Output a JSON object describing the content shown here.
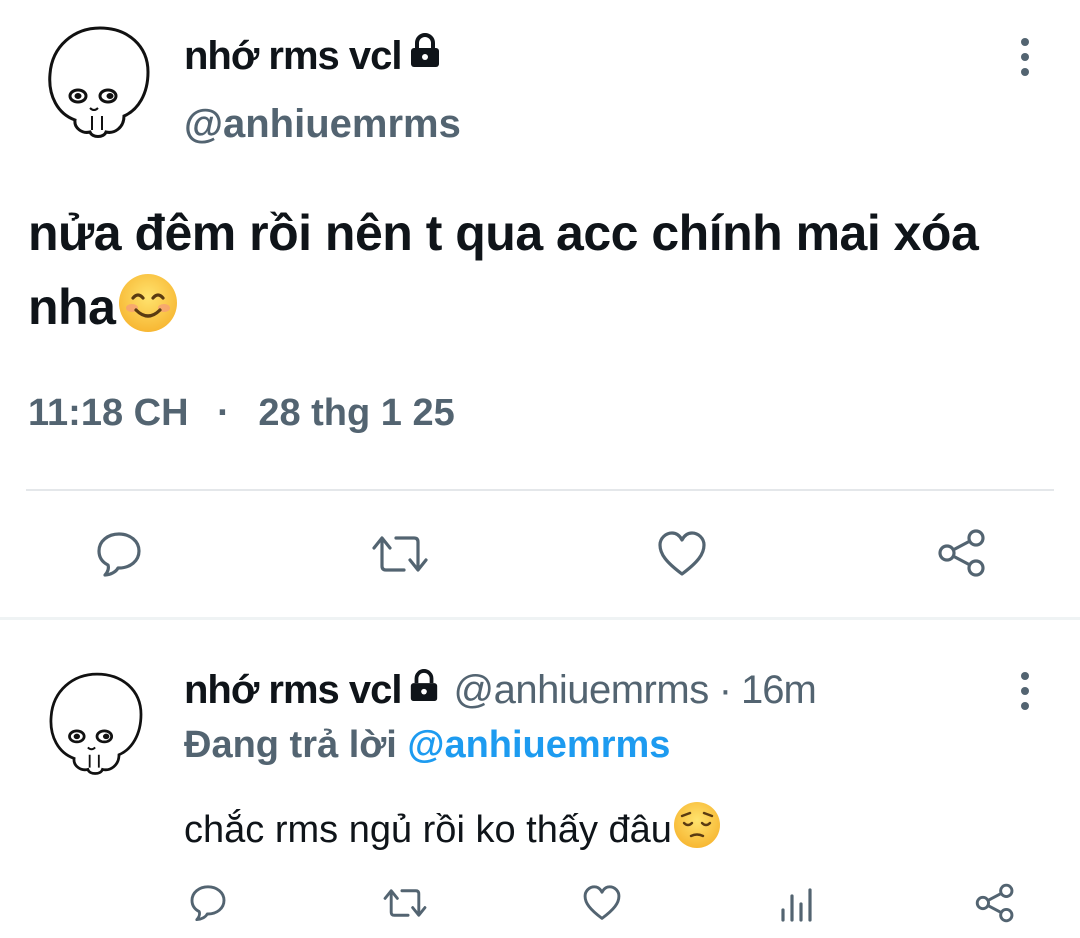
{
  "main_tweet": {
    "display_name": "nhớ rms vcl",
    "handle": "@anhiuemrms",
    "text": "nửa đêm rồi nên t qua acc chính mai xóa nha",
    "text_line1": "nửa đêm rồi nên t qua acc chính mai xóa",
    "text_line2": "nha",
    "emoji": "smiling-face-emoji",
    "time": "11:18 CH",
    "separator": "·",
    "date": "28 thg 1 25",
    "actions": [
      "reply-icon",
      "retweet-icon",
      "like-icon",
      "share-icon"
    ]
  },
  "reply_tweet": {
    "display_name": "nhớ rms vcl",
    "handle": "@anhiuemrms",
    "separator": "·",
    "age": "16m",
    "replying_prefix": "Đang trả lời",
    "replying_to": "@anhiuemrms",
    "text": "chắc rms ngủ rồi ko thấy đâu",
    "emoji": "pensive-face-emoji",
    "actions": [
      "reply-icon",
      "retweet-icon",
      "like-icon",
      "views-icon",
      "share-icon"
    ]
  },
  "colors": {
    "text": "#0f1419",
    "muted": "#536471",
    "link": "#1d9bf0",
    "divider": "#eff3f4"
  }
}
